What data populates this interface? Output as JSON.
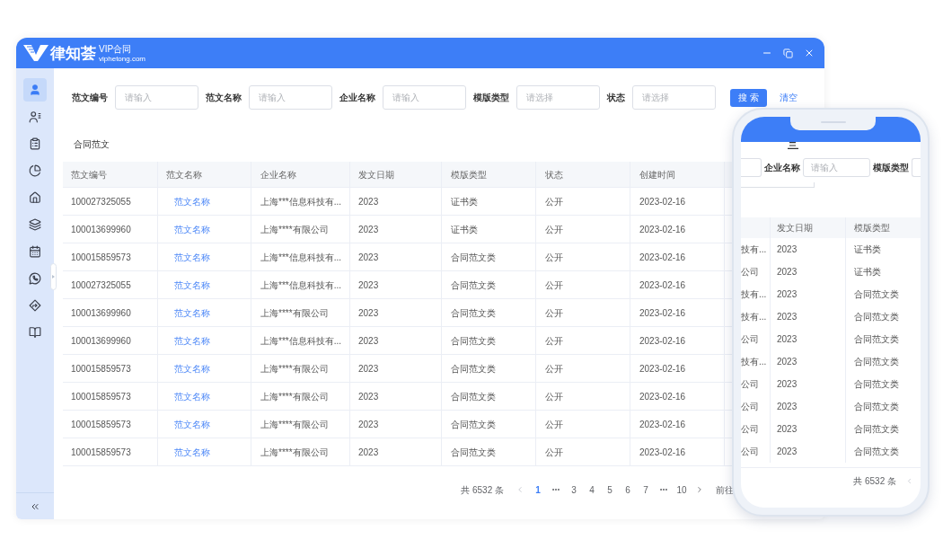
{
  "window": {
    "logo_text": "律知荟",
    "logo_badge": "VIP合同",
    "logo_domain": "viphetong.com"
  },
  "sidebar": {
    "items": [
      {
        "kind": "user",
        "selected": true
      },
      {
        "kind": "user-list",
        "selected": false
      },
      {
        "kind": "clipboard",
        "selected": false
      },
      {
        "kind": "pie-chart",
        "selected": false
      },
      {
        "kind": "home",
        "selected": false
      },
      {
        "kind": "layers",
        "selected": false
      },
      {
        "kind": "calendar",
        "selected": false
      },
      {
        "kind": "phone-chat",
        "selected": false
      },
      {
        "kind": "direction",
        "selected": false
      },
      {
        "kind": "book",
        "selected": false
      }
    ]
  },
  "search": {
    "fields": [
      {
        "label": "范文编号",
        "placeholder": "请输入"
      },
      {
        "label": "范文名称",
        "placeholder": "请输入"
      },
      {
        "label": "企业名称",
        "placeholder": "请输入"
      },
      {
        "label": "模版类型",
        "placeholder": "请选择"
      },
      {
        "label": "状态",
        "placeholder": "请选择"
      }
    ],
    "search_button": "搜 索",
    "clear_button": "清空"
  },
  "section_title": "合同范文",
  "table": {
    "columns": [
      {
        "label": "范文编号",
        "kind": "text"
      },
      {
        "label": "范文名称",
        "kind": "link"
      },
      {
        "label": "企业名称",
        "kind": "text"
      },
      {
        "label": "发文日期",
        "kind": "text"
      },
      {
        "label": "模版类型",
        "kind": "text"
      },
      {
        "label": "状态",
        "kind": "text"
      },
      {
        "label": "创建时间",
        "kind": "text"
      }
    ],
    "rows": [
      [
        "100027325055",
        "范文名称",
        "上海***信息科技有...",
        "2023",
        "证书类",
        "公开",
        "2023-02-16"
      ],
      [
        "100013699960",
        "范文名称",
        "上海****有限公司",
        "2023",
        "证书类",
        "公开",
        "2023-02-16"
      ],
      [
        "100015859573",
        "范文名称",
        "上海***信息科技有...",
        "2023",
        "合同范文类",
        "公开",
        "2023-02-16"
      ],
      [
        "100027325055",
        "范文名称",
        "上海***信息科技有...",
        "2023",
        "合同范文类",
        "公开",
        "2023-02-16"
      ],
      [
        "100013699960",
        "范文名称",
        "上海****有限公司",
        "2023",
        "合同范文类",
        "公开",
        "2023-02-16"
      ],
      [
        "100013699960",
        "范文名称",
        "上海***信息科技有...",
        "2023",
        "合同范文类",
        "公开",
        "2023-02-16"
      ],
      [
        "100015859573",
        "范文名称",
        "上海****有限公司",
        "2023",
        "合同范文类",
        "公开",
        "2023-02-16"
      ],
      [
        "100015859573",
        "范文名称",
        "上海****有限公司",
        "2023",
        "合同范文类",
        "公开",
        "2023-02-16"
      ],
      [
        "100015859573",
        "范文名称",
        "上海****有限公司",
        "2023",
        "合同范文类",
        "公开",
        "2023-02-16"
      ],
      [
        "100015859573",
        "范文名称",
        "上海****有限公司",
        "2023",
        "合同范文类",
        "公开",
        "2023-02-16"
      ]
    ]
  },
  "pagination": {
    "total": "共 6532 条",
    "pages": [
      {
        "kind": "page",
        "label": "1",
        "selected": true
      },
      {
        "kind": "more",
        "selected": false
      },
      {
        "kind": "page",
        "label": "3",
        "selected": false
      },
      {
        "kind": "page",
        "label": "4",
        "selected": false
      },
      {
        "kind": "page",
        "label": "5",
        "selected": false
      },
      {
        "kind": "page",
        "label": "6",
        "selected": false
      },
      {
        "kind": "page",
        "label": "7",
        "selected": false
      },
      {
        "kind": "more",
        "selected": false
      },
      {
        "kind": "page",
        "label": "10",
        "selected": false
      }
    ],
    "jumper_label": "前往"
  },
  "phone": {
    "fields": [
      {
        "kind": "input"
      },
      {
        "kind": "label",
        "text": "企业名称"
      },
      {
        "kind": "input",
        "placeholder": "请输入"
      },
      {
        "kind": "label",
        "text": "模版类型"
      },
      {
        "kind": "input"
      }
    ],
    "table": {
      "columns": [
        {
          "kind": "cut"
        },
        {
          "kind": "text",
          "label": "发文日期"
        },
        {
          "kind": "text",
          "label": "模版类型"
        }
      ],
      "rows": [
        [
          "技有...",
          "2023",
          "证书类"
        ],
        [
          "公司",
          "2023",
          "证书类"
        ],
        [
          "技有...",
          "2023",
          "合同范文类"
        ],
        [
          "技有...",
          "2023",
          "合同范文类"
        ],
        [
          "公司",
          "2023",
          "合同范文类"
        ],
        [
          "技有...",
          "2023",
          "合同范文类"
        ],
        [
          "公司",
          "2023",
          "合同范文类"
        ],
        [
          "公司",
          "2023",
          "合同范文类"
        ],
        [
          "公司",
          "2023",
          "合同范文类"
        ],
        [
          "公司",
          "2023",
          "合同范文类"
        ]
      ]
    },
    "pagination": {
      "total": "共 6532 条"
    }
  }
}
